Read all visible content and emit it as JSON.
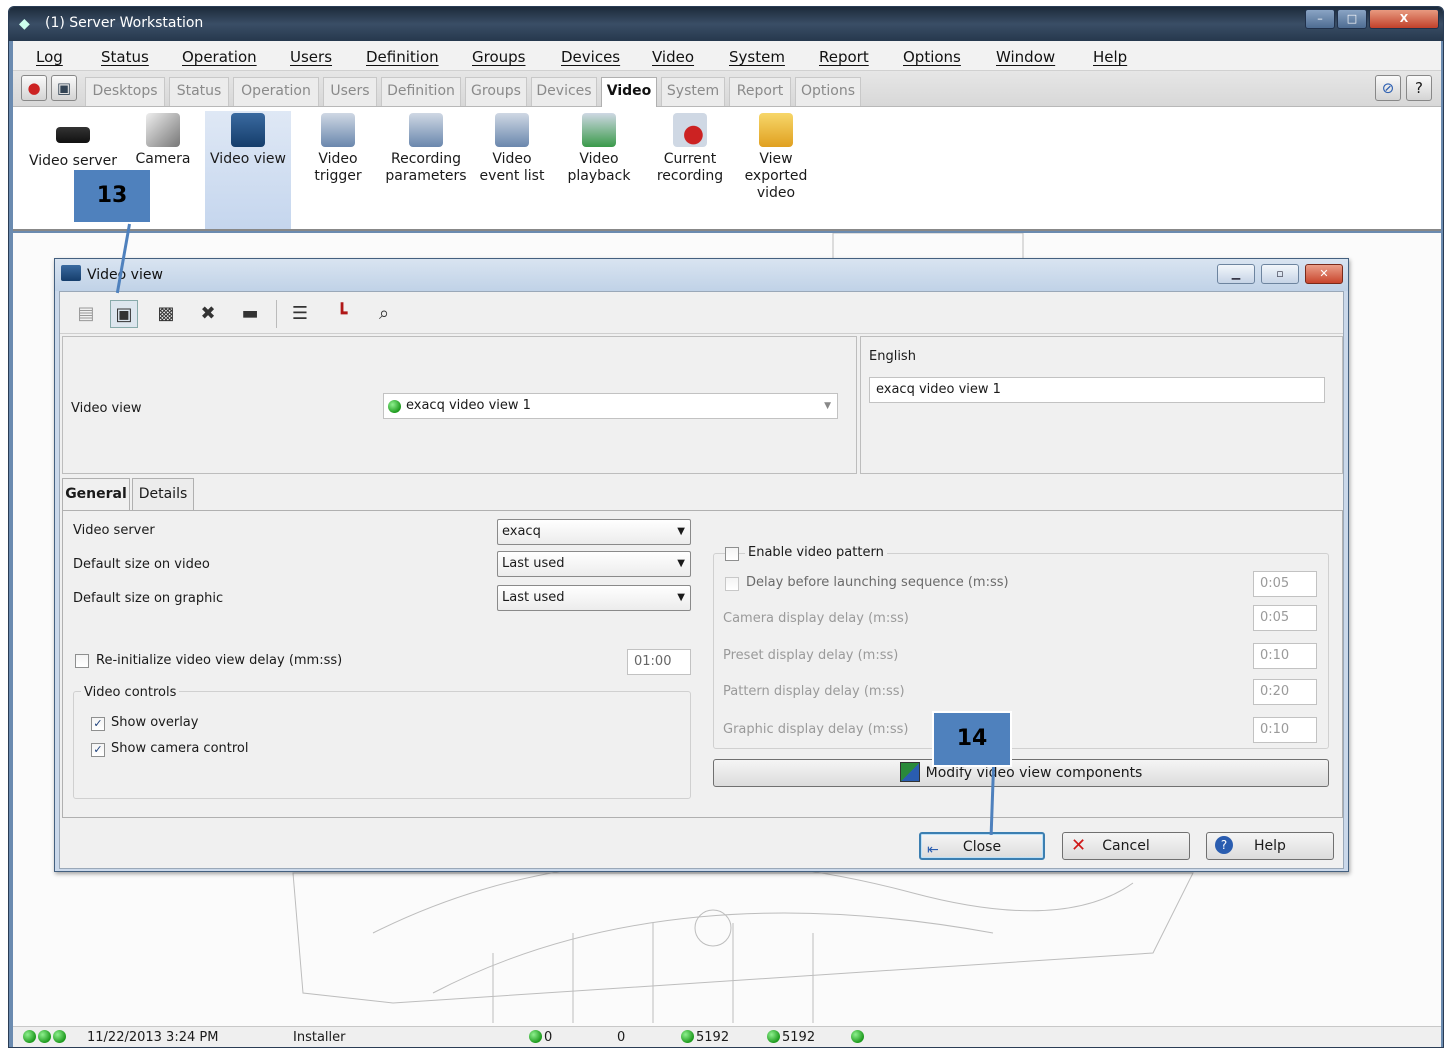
{
  "window": {
    "title": "(1) Server Workstation",
    "min": "–",
    "max": "□",
    "close": "X"
  },
  "menu": [
    "Log",
    "Status",
    "Operation",
    "Users",
    "Definition",
    "Groups",
    "Devices",
    "Video",
    "System",
    "Report",
    "Options",
    "Window",
    "Help"
  ],
  "ribbon_tabs": [
    "Desktops",
    "Status",
    "Operation",
    "Users",
    "Definition",
    "Groups",
    "Devices",
    "Video",
    "System",
    "Report",
    "Options"
  ],
  "ribbon_buttons": [
    "Video server",
    "Camera",
    "Video view",
    "Video trigger",
    "Recording parameters",
    "Video event list",
    "Video playback",
    "Current recording",
    "View exported video"
  ],
  "dialog": {
    "title": "Video view",
    "header": {
      "label": "Video view",
      "value": "exacq video view 1",
      "lang_label": "English",
      "lang_value": "exacq video view 1"
    },
    "tabs": [
      "General",
      "Details"
    ],
    "general": {
      "video_server_label": "Video server",
      "video_server_value": "exacq",
      "default_size_video_label": "Default size on video",
      "default_size_video_value": "Last used",
      "default_size_graphic_label": "Default size on graphic",
      "default_size_graphic_value": "Last used",
      "reinit_label": "Re-initialize video view delay (mm:ss)",
      "reinit_value": "01:00",
      "video_controls_label": "Video controls",
      "show_overlay": "Show overlay",
      "show_camera_control": "Show camera control",
      "enable_pattern": "Enable video pattern",
      "delay_launch": "Delay before launching sequence (m:ss)",
      "delay_launch_value": "0:05",
      "camera_delay": "Camera display delay (m:ss)",
      "camera_delay_value": "0:05",
      "preset_delay": "Preset display delay (m:ss)",
      "preset_delay_value": "0:10",
      "pattern_delay": "Pattern display delay (m:ss)",
      "pattern_delay_value": "0:20",
      "graphic_delay": "Graphic display delay (m:ss)",
      "graphic_delay_value": "0:10",
      "modify_button": "Modify video view components"
    },
    "buttons": {
      "close": "Close",
      "cancel": "Cancel",
      "help": "Help"
    }
  },
  "callouts": {
    "c13": "13",
    "c14": "14"
  },
  "statusbar": {
    "datetime": "11/22/2013 3:24 PM",
    "user": "Installer",
    "v1": "0",
    "v2": "0",
    "v3": "5192",
    "v4": "5192"
  }
}
